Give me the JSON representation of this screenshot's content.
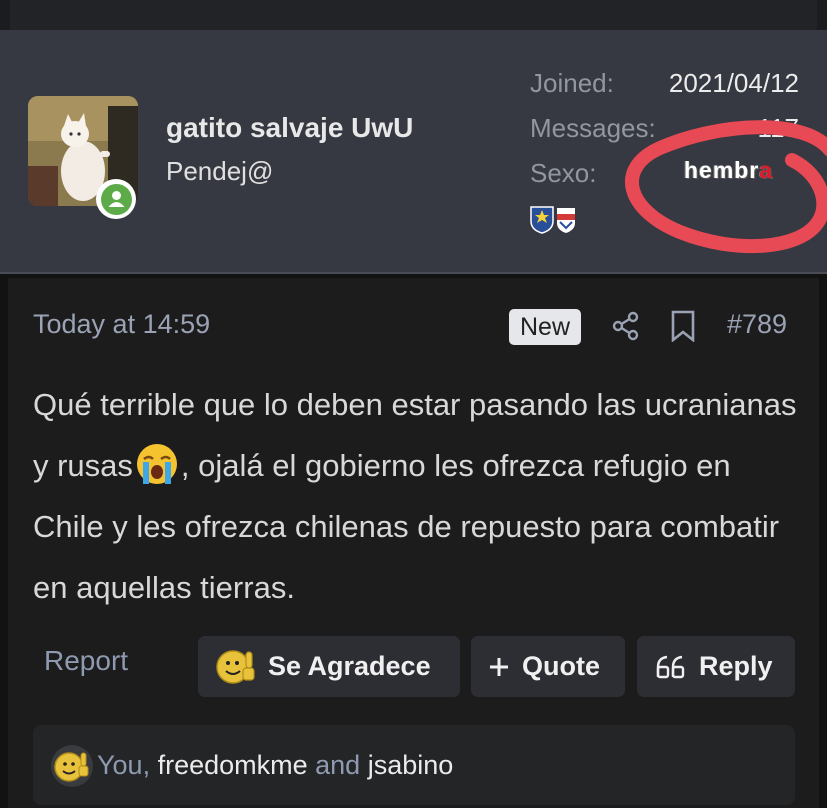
{
  "user": {
    "name": "gatito salvaje UwU",
    "title": "Pendej@",
    "stats": [
      {
        "label": "Joined:",
        "value": "2021/04/12"
      },
      {
        "label": "Messages:",
        "value": "117"
      },
      {
        "label": "Sexo:",
        "value": "hembr",
        "value_last_letter": "a"
      }
    ]
  },
  "post": {
    "date": "Today at 14:59",
    "new_badge": "New",
    "number": "#789",
    "body_part1": "Qué terrible que lo deben estar pasando las ucranianas y rusas",
    "body_part2": ", ojalá el gobierno les ofrezca refugio en Chile y les ofrezca chilenas de repuesto para combatir en aquellas tierras."
  },
  "actions": {
    "report": "Report",
    "react": "Se Agradece",
    "quote": "Quote",
    "reply": "Reply"
  },
  "reactions": {
    "you": "You",
    "sep1": ", ",
    "user1": "freedomkme",
    "sep2": " and ",
    "user2": "jsabino"
  },
  "colors": {
    "header_bg": "#363941",
    "post_bg": "#1c1c1d",
    "online": "#5cab48",
    "annotation": "#e84a55"
  }
}
